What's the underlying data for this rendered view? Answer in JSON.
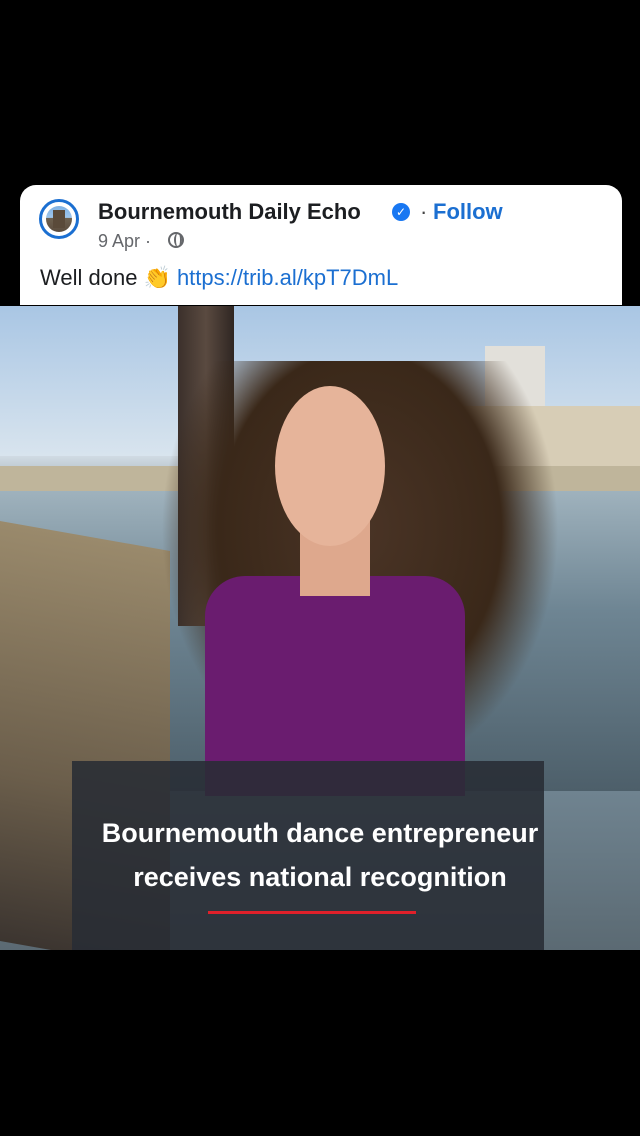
{
  "post": {
    "page_name": "Bournemouth Daily Echo",
    "separator": "·",
    "follow_label": "Follow",
    "date": "9 Apr ·",
    "text": "Well done 👏",
    "link": "https://trib.al/kpT7DmL"
  },
  "image": {
    "caption_line1": "Bournemouth dance entrepreneur",
    "caption_line2": "receives national recognition"
  }
}
